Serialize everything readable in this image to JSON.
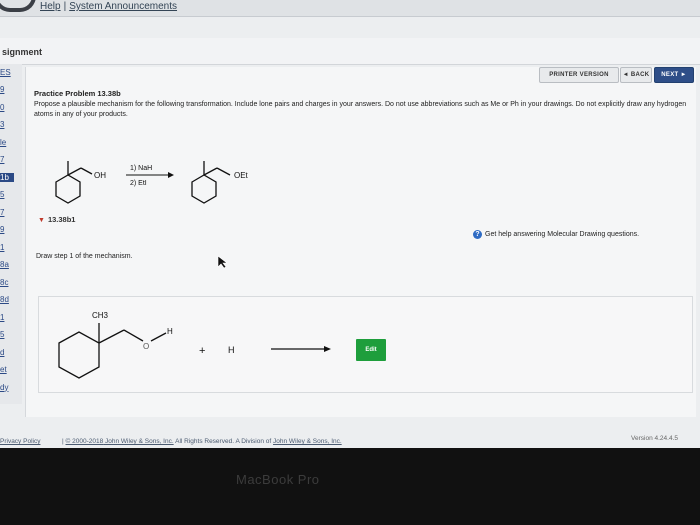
{
  "header": {
    "links": [
      "Help",
      "System Announcements"
    ]
  },
  "assignment": {
    "title": "signment"
  },
  "nav": {
    "items": [
      "ES",
      "9",
      "0",
      "3",
      "le",
      "7",
      "1b",
      "5",
      "7",
      "9",
      "1",
      "8a",
      "8c",
      "8d",
      "1",
      "5",
      "d",
      "et",
      "dy"
    ],
    "highlighted_index": 6
  },
  "toolbar": {
    "printer_label": "PRINTER VERSION",
    "back_label": "◄ BACK",
    "next_label": "NEXT ►"
  },
  "problem": {
    "title": "Practice Problem 13.38b",
    "text": "Propose a plausible mechanism for the following transformation. Include lone pairs and charges in your answers. Do not use abbreviations such as Me or Ph in your drawings. Do not explicitly draw any hydrogen atoms in any of your products.",
    "reactant_label": "OH",
    "reagent_1": "1) NaH",
    "reagent_2": "2) EtI",
    "product_label": "OEt"
  },
  "subpart": {
    "label": "13.38b1",
    "help_text": "Get help answering Molecular Drawing questions.",
    "step_label": "Draw step 1 of the mechanism.",
    "edit_label": "Edit",
    "mol_ch3": "CH3",
    "mol_o": "O",
    "mol_h": "H",
    "plus": "+",
    "hydride": "H"
  },
  "footer": {
    "policy": "Privacy Policy",
    "separator": "|",
    "copyright_prefix": "© 2000-2018",
    "company": "John Wiley & Sons, Inc.",
    "rights": "All Rights Reserved. A Division of",
    "version": "Version 4.24.4.5"
  },
  "device": {
    "label": "MacBook Pro"
  }
}
